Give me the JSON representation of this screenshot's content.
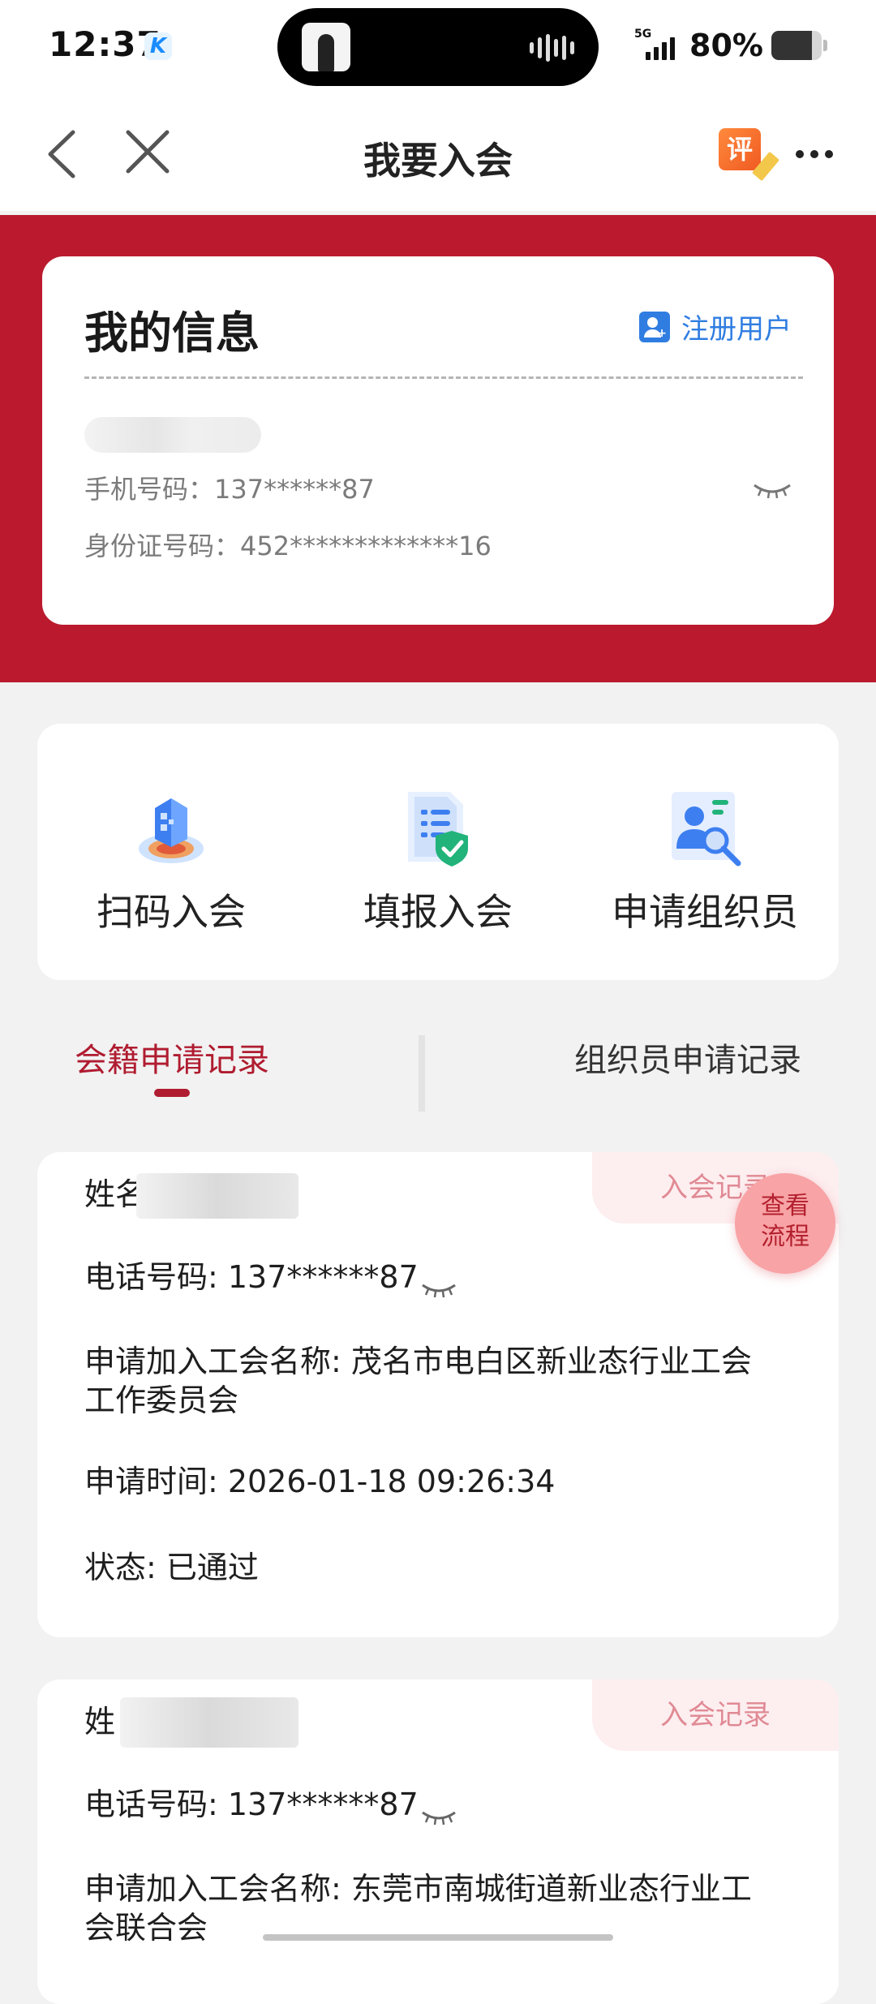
{
  "status_bar": {
    "time": "12:37",
    "app_badge": "K",
    "network": "5G",
    "battery_percent": "80%",
    "battery_level": 0.8
  },
  "nav": {
    "title": "我要入会",
    "review_icon_text": "评"
  },
  "my_info": {
    "title": "我的信息",
    "register_label": "注册用户",
    "phone_line": "手机号码：137******87",
    "id_line": "身份证号码：452*************16"
  },
  "actions": [
    {
      "label": "扫码入会",
      "icon": "scan-qr-icon"
    },
    {
      "label": "填报入会",
      "icon": "form-check-icon"
    },
    {
      "label": "申请组织员",
      "icon": "organizer-search-icon"
    }
  ],
  "tabs": {
    "active": "会籍申请记录",
    "inactive": "组织员申请记录"
  },
  "records": [
    {
      "tag": "入会记录",
      "name_label": "姓名: ",
      "phone": "电话号码: 137******87",
      "union_line1": "申请加入工会名称: 茂名市电白区新业态行业工会",
      "union_line2": "工作委员会",
      "time": "申请时间: 2026-01-18 09:26:34",
      "status": "状态: 已通过"
    },
    {
      "tag": "入会记录",
      "name_label": "姓",
      "phone": "电话号码: 137******87",
      "union_line1": "申请加入工会名称: 东莞市南城街道新业态行业工",
      "union_line2": "会联合会"
    }
  ],
  "flow_button": {
    "line1": "查看",
    "line2": "流程"
  },
  "colors": {
    "brand_red": "#bb1a2e",
    "link_blue": "#2f7de1",
    "tag_pink": "#fdeef0"
  }
}
